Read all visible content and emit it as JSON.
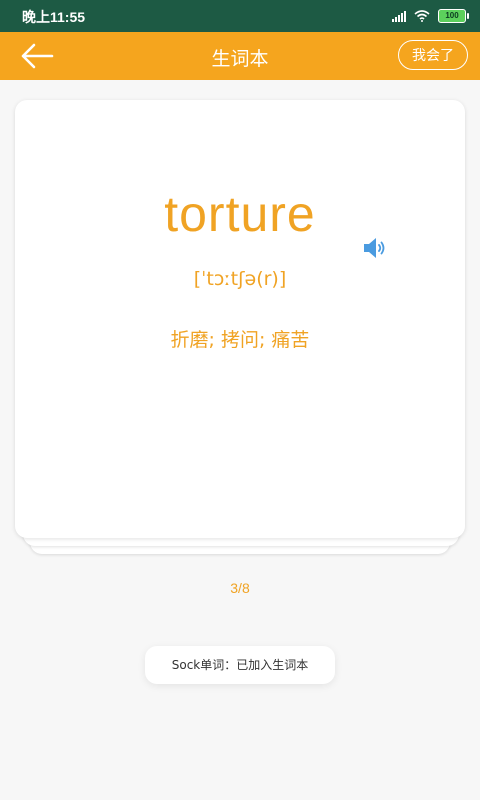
{
  "status_bar": {
    "time": "晚上11:55",
    "battery": "100",
    "icons": [
      "signal-icon",
      "wifi-icon",
      "battery-icon"
    ]
  },
  "header": {
    "title": "生词本",
    "back_icon": "arrow-left-icon",
    "known_button": "我会了"
  },
  "card": {
    "word": "torture",
    "phonetic": "[ˈtɔːtʃə(r)]",
    "meaning": "折磨; 拷问; 痛苦",
    "speaker_icon": "speaker-icon"
  },
  "progress": "3/8",
  "toast": "Sock单词：已加入生词本",
  "colors": {
    "status_bar": "#1d5a44",
    "header": "#f5a51e",
    "accent": "#f0a324",
    "speaker": "#4a9be0",
    "background": "#f7f7f7"
  }
}
